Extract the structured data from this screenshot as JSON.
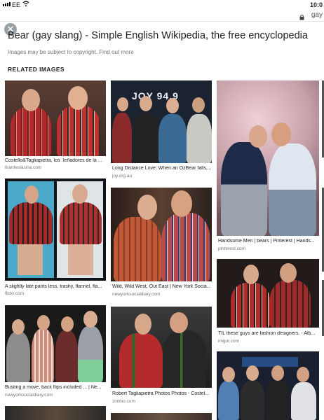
{
  "status": {
    "carrier": "EE",
    "time": "10:0"
  },
  "browser": {
    "url_text": "gay"
  },
  "viewer": {
    "title": "Bear (gay slang) - Simple English Wikipedia, the free encyclopedia",
    "copyright": "Images may be subject to copyright. Find out more",
    "related_heading": "RELATED IMAGES"
  },
  "related": [
    {
      "caption": "Costello&Tagliapietra, los ´leñadores de la ...",
      "source": "tiranteslasina.com"
    },
    {
      "caption": "Long Distance Love: When an OzBear falls,...",
      "source": "joy.org.au"
    },
    {
      "caption": "Handsome Men | bears | Pinterest | Hands...",
      "source": "pinterest.com"
    },
    {
      "caption": "A slightly late pants less, trashy, flannel, fla...",
      "source": "flickr.com"
    },
    {
      "caption": "Wild, Wild West, Out East | New York Socia...",
      "source": "newyorksocialdiary.com"
    },
    {
      "caption": "TIL these guys are fashion designers. - Alb...",
      "source": "imgur.com"
    },
    {
      "caption": "Busting a move, back flips included ... | Ne...",
      "source": "newyorksocialdiary.com"
    },
    {
      "caption": "Robert Tagliapietra Photos Photos - Costel...",
      "source": "zimbio.com"
    }
  ],
  "photo_text": {
    "joy_sign": "JOY 94.9"
  },
  "icons": [
    "signal-icon",
    "wifi-icon",
    "lock-icon",
    "close-icon"
  ]
}
